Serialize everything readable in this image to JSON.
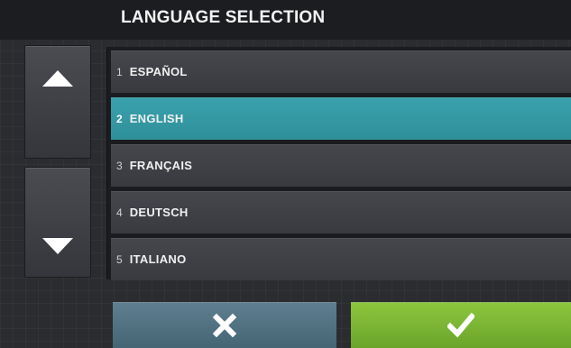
{
  "header": {
    "title": "LANGUAGE SELECTION"
  },
  "scroll": {
    "up_icon": "arrow-up-icon",
    "down_icon": "arrow-down-icon"
  },
  "languages": [
    {
      "number": "1",
      "label": "ESPAÑOL",
      "selected": false
    },
    {
      "number": "2",
      "label": "ENGLISH",
      "selected": true
    },
    {
      "number": "3",
      "label": "FRANÇAIS",
      "selected": false
    },
    {
      "number": "4",
      "label": "DEUTSCH",
      "selected": false
    },
    {
      "number": "5",
      "label": "ITALIANO",
      "selected": false
    }
  ],
  "actions": {
    "cancel_icon": "close-icon",
    "confirm_icon": "checkmark-icon"
  },
  "colors": {
    "selected": "#3399a4",
    "cancel": "#52717f",
    "confirm": "#7cb834",
    "background": "#2b2c30"
  }
}
